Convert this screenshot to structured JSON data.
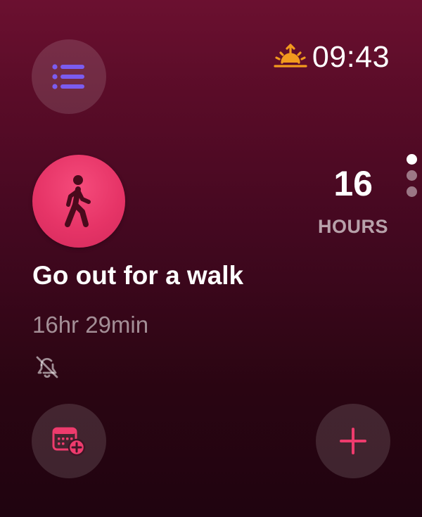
{
  "status": {
    "time": "09:43",
    "sunrise_icon": "sunrise-icon",
    "sunrise_color": "#f29a1e"
  },
  "toolbar": {
    "list_icon": "list-icon",
    "list_icon_color": "#7b5cf0",
    "calendar_icon": "calendar-add-icon",
    "add_icon": "plus-icon",
    "accent_color": "#ee3b6d"
  },
  "activity": {
    "icon": "walking-figure-icon",
    "title": "Go out for a walk",
    "duration": "16hr 29min",
    "alert_icon": "bell-slash-icon"
  },
  "countdown": {
    "value": "16",
    "unit": "HOURS"
  },
  "pagination": {
    "count": 3,
    "active_index": 0
  }
}
